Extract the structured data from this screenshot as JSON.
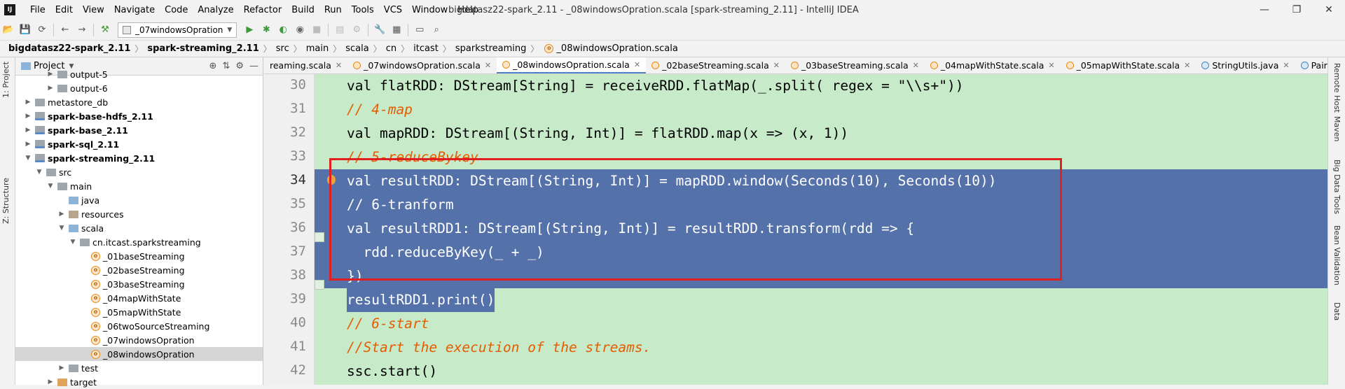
{
  "window": {
    "title": "bigdatasz22-spark_2.11 - _08windowsOpration.scala [spark-streaming_2.11] - IntelliJ IDEA",
    "logo": "IJ",
    "menu": [
      "File",
      "Edit",
      "View",
      "Navigate",
      "Code",
      "Analyze",
      "Refactor",
      "Build",
      "Run",
      "Tools",
      "VCS",
      "Window",
      "Help"
    ],
    "controls": {
      "minimize": "—",
      "restore": "❐",
      "close": "✕"
    }
  },
  "toolbar": {
    "run_config": "_07windowsOpration"
  },
  "breadcrumb": [
    "bigdatasz22-spark_2.11",
    "spark-streaming_2.11",
    "src",
    "main",
    "scala",
    "cn",
    "itcast",
    "sparkstreaming",
    "_08windowsOpration.scala"
  ],
  "left_strip": {
    "project_tab": "1: Project",
    "structure_tab": "Z: Structure"
  },
  "project_panel": {
    "title": "Project",
    "tree": [
      {
        "label": "output-5",
        "bold": false
      },
      {
        "label": "output-6",
        "bold": false
      },
      {
        "label": "metastore_db",
        "bold": false
      },
      {
        "label": "spark-base-hdfs_2.11",
        "bold": true
      },
      {
        "label": "spark-base_2.11",
        "bold": true
      },
      {
        "label": "spark-sql_2.11",
        "bold": true
      },
      {
        "label": "spark-streaming_2.11",
        "bold": true
      },
      {
        "label": "src",
        "bold": false
      },
      {
        "label": "main",
        "bold": false
      },
      {
        "label": "java",
        "bold": false
      },
      {
        "label": "resources",
        "bold": false
      },
      {
        "label": "scala",
        "bold": false
      },
      {
        "label": "cn.itcast.sparkstreaming",
        "bold": false
      },
      {
        "label": "_01baseStreaming",
        "bold": false
      },
      {
        "label": "_02baseStreaming",
        "bold": false
      },
      {
        "label": "_03baseStreaming",
        "bold": false
      },
      {
        "label": "_04mapWithState",
        "bold": false
      },
      {
        "label": "_05mapWithState",
        "bold": false
      },
      {
        "label": "_06twoSourceStreaming",
        "bold": false
      },
      {
        "label": "_07windowsOpration",
        "bold": false
      },
      {
        "label": "_08windowsOpration",
        "bold": false
      },
      {
        "label": "test",
        "bold": false
      },
      {
        "label": "target",
        "bold": false
      }
    ]
  },
  "tabs": [
    {
      "label": "reaming.scala",
      "icon": "scala",
      "active": false
    },
    {
      "label": "_07windowsOpration.scala",
      "icon": "scala",
      "active": false
    },
    {
      "label": "_08windowsOpration.scala",
      "icon": "scala",
      "active": true
    },
    {
      "label": "_02baseStreaming.scala",
      "icon": "scala",
      "active": false
    },
    {
      "label": "_03baseStreaming.scala",
      "icon": "scala",
      "active": false
    },
    {
      "label": "_04mapWithState.scala",
      "icon": "scala",
      "active": false
    },
    {
      "label": "_05mapWithState.scala",
      "icon": "scala",
      "active": false
    },
    {
      "label": "StringUtils.java",
      "icon": "java",
      "active": false
    },
    {
      "label": "PairDStreamFunc",
      "icon": "java",
      "active": false
    }
  ],
  "code_lines": [
    {
      "n": "30",
      "code": "val flatRDD: DStream[String] = receiveRDD.flatMap(_.split( regex = \"\\\\s+\"))"
    },
    {
      "n": "31",
      "code": "// 4-map"
    },
    {
      "n": "32",
      "code": "val mapRDD: DStream[(String, Int)] = flatRDD.map(x => (x, 1))"
    },
    {
      "n": "33",
      "code": "// 5-reduceBykey"
    },
    {
      "n": "34",
      "code": "val resultRDD: DStream[(String, Int)] = mapRDD.window(Seconds(10), Seconds(10))"
    },
    {
      "n": "35",
      "code": "// 6-tranform"
    },
    {
      "n": "36",
      "code": "val resultRDD1: DStream[(String, Int)] = resultRDD.transform(rdd => {"
    },
    {
      "n": "37",
      "code": "  rdd.reduceByKey(_ + _)"
    },
    {
      "n": "38",
      "code": "})"
    },
    {
      "n": "39",
      "code": "resultRDD1.print()"
    },
    {
      "n": "40",
      "code": "// 6-start"
    },
    {
      "n": "41",
      "code": "//Start the execution of the streams."
    },
    {
      "n": "42",
      "code": "ssc.start()"
    }
  ],
  "right_strip": [
    "Remote Host",
    "Maven",
    "Big Data Tools",
    "Bean Validation",
    "Data"
  ],
  "colors": {
    "editor_bg": "#c7ebc9",
    "selection": "#5472a9",
    "annotation_box": "#e02020"
  }
}
